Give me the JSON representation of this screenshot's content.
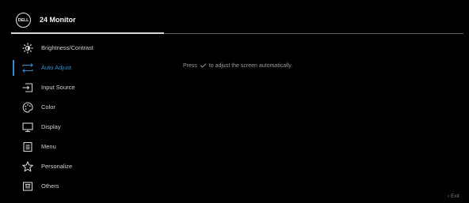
{
  "header": {
    "logo_text": "DELL",
    "title": "24 Monitor"
  },
  "menu": {
    "items": [
      {
        "label": "Brightness/Contrast",
        "icon": "brightness-icon"
      },
      {
        "label": "Auto Adjust",
        "icon": "auto-adjust-icon",
        "active": true
      },
      {
        "label": "Input Source",
        "icon": "input-source-icon"
      },
      {
        "label": "Color",
        "icon": "color-palette-icon"
      },
      {
        "label": "Display",
        "icon": "display-monitor-icon"
      },
      {
        "label": "Menu",
        "icon": "menu-document-icon"
      },
      {
        "label": "Personalize",
        "icon": "star-icon"
      },
      {
        "label": "Others",
        "icon": "others-icon"
      }
    ]
  },
  "content": {
    "desc_prefix": "Press",
    "desc_suffix": "to adjust the  screen automatically."
  },
  "footer": {
    "exit_label": "Exit",
    "exit_icon": "chevron-left-icon"
  },
  "colors": {
    "accent": "#2f8bd0",
    "background": "#000000",
    "text": "#d0d0d0"
  }
}
